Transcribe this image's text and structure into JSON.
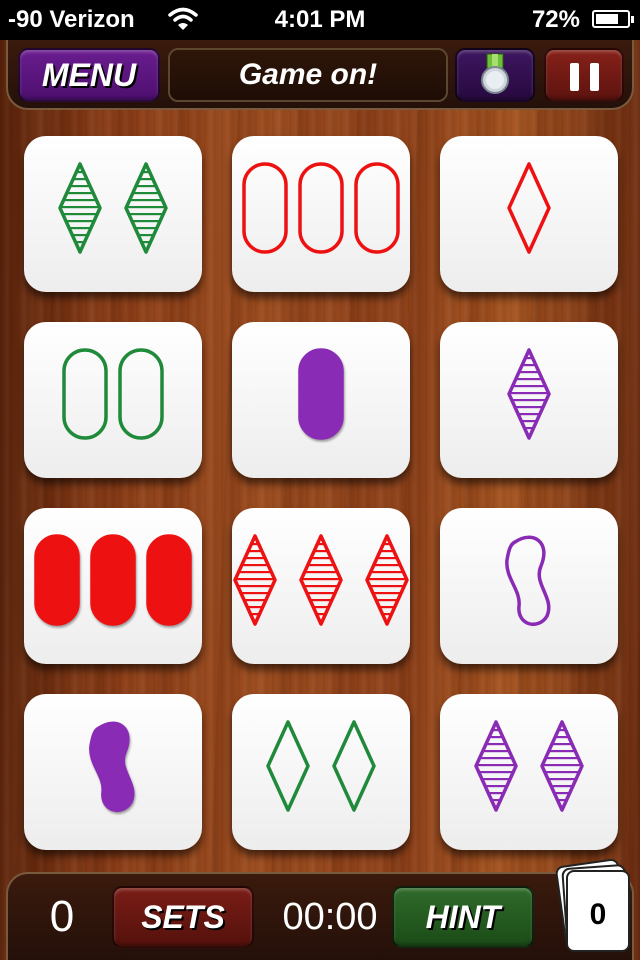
{
  "status_bar": {
    "carrier": "-90 Verizon",
    "time": "4:01 PM",
    "battery_percent": "72%",
    "battery_level": 0.72
  },
  "top_bar": {
    "menu_label": "MENU",
    "message": "Game on!",
    "medal_icon": "medal-icon",
    "pause_icon": "pause-icon"
  },
  "colors": {
    "green": "#1f8a3a",
    "red": "#ee1111",
    "purple": "#8a2bb5"
  },
  "cards": [
    {
      "count": 2,
      "shape": "diamond",
      "color": "green",
      "fill": "striped"
    },
    {
      "count": 3,
      "shape": "oval",
      "color": "red",
      "fill": "empty"
    },
    {
      "count": 1,
      "shape": "diamond",
      "color": "red",
      "fill": "empty"
    },
    {
      "count": 2,
      "shape": "oval",
      "color": "green",
      "fill": "empty"
    },
    {
      "count": 1,
      "shape": "oval",
      "color": "purple",
      "fill": "solid"
    },
    {
      "count": 1,
      "shape": "diamond",
      "color": "purple",
      "fill": "striped"
    },
    {
      "count": 3,
      "shape": "oval",
      "color": "red",
      "fill": "solid"
    },
    {
      "count": 3,
      "shape": "diamond",
      "color": "red",
      "fill": "striped"
    },
    {
      "count": 1,
      "shape": "squiggle",
      "color": "purple",
      "fill": "empty"
    },
    {
      "count": 1,
      "shape": "squiggle",
      "color": "purple",
      "fill": "solid"
    },
    {
      "count": 2,
      "shape": "diamond",
      "color": "green",
      "fill": "empty"
    },
    {
      "count": 2,
      "shape": "diamond",
      "color": "purple",
      "fill": "striped"
    }
  ],
  "bottom_bar": {
    "score": "0",
    "sets_label": "SETS",
    "timer": "00:00",
    "hint_label": "HINT",
    "deck_count": "0"
  }
}
